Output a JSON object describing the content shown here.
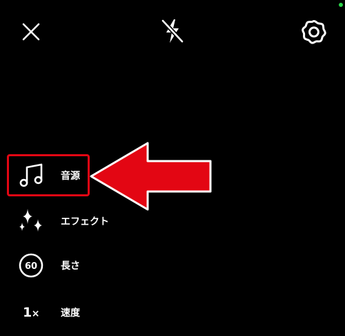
{
  "colors": {
    "background": "#000000",
    "foreground": "#ffffff",
    "annotation": "#e30613",
    "status_dot": "#2bd34a"
  },
  "top_bar": {
    "close_icon": "close-icon",
    "flash_icon": "flash-off-icon",
    "settings_icon": "gear-icon"
  },
  "menu": {
    "items": [
      {
        "id": "sound",
        "icon": "music-note-icon",
        "label": "音源"
      },
      {
        "id": "effects",
        "icon": "sparkles-icon",
        "label": "エフェクト"
      },
      {
        "id": "length",
        "icon": "duration-icon",
        "icon_text": "60",
        "label": "長さ"
      },
      {
        "id": "speed",
        "icon": "speed-icon",
        "icon_text": "1",
        "icon_suffix": "×",
        "label": "速度"
      }
    ]
  },
  "annotation": {
    "type": "arrow",
    "direction": "left",
    "target": "sound"
  }
}
